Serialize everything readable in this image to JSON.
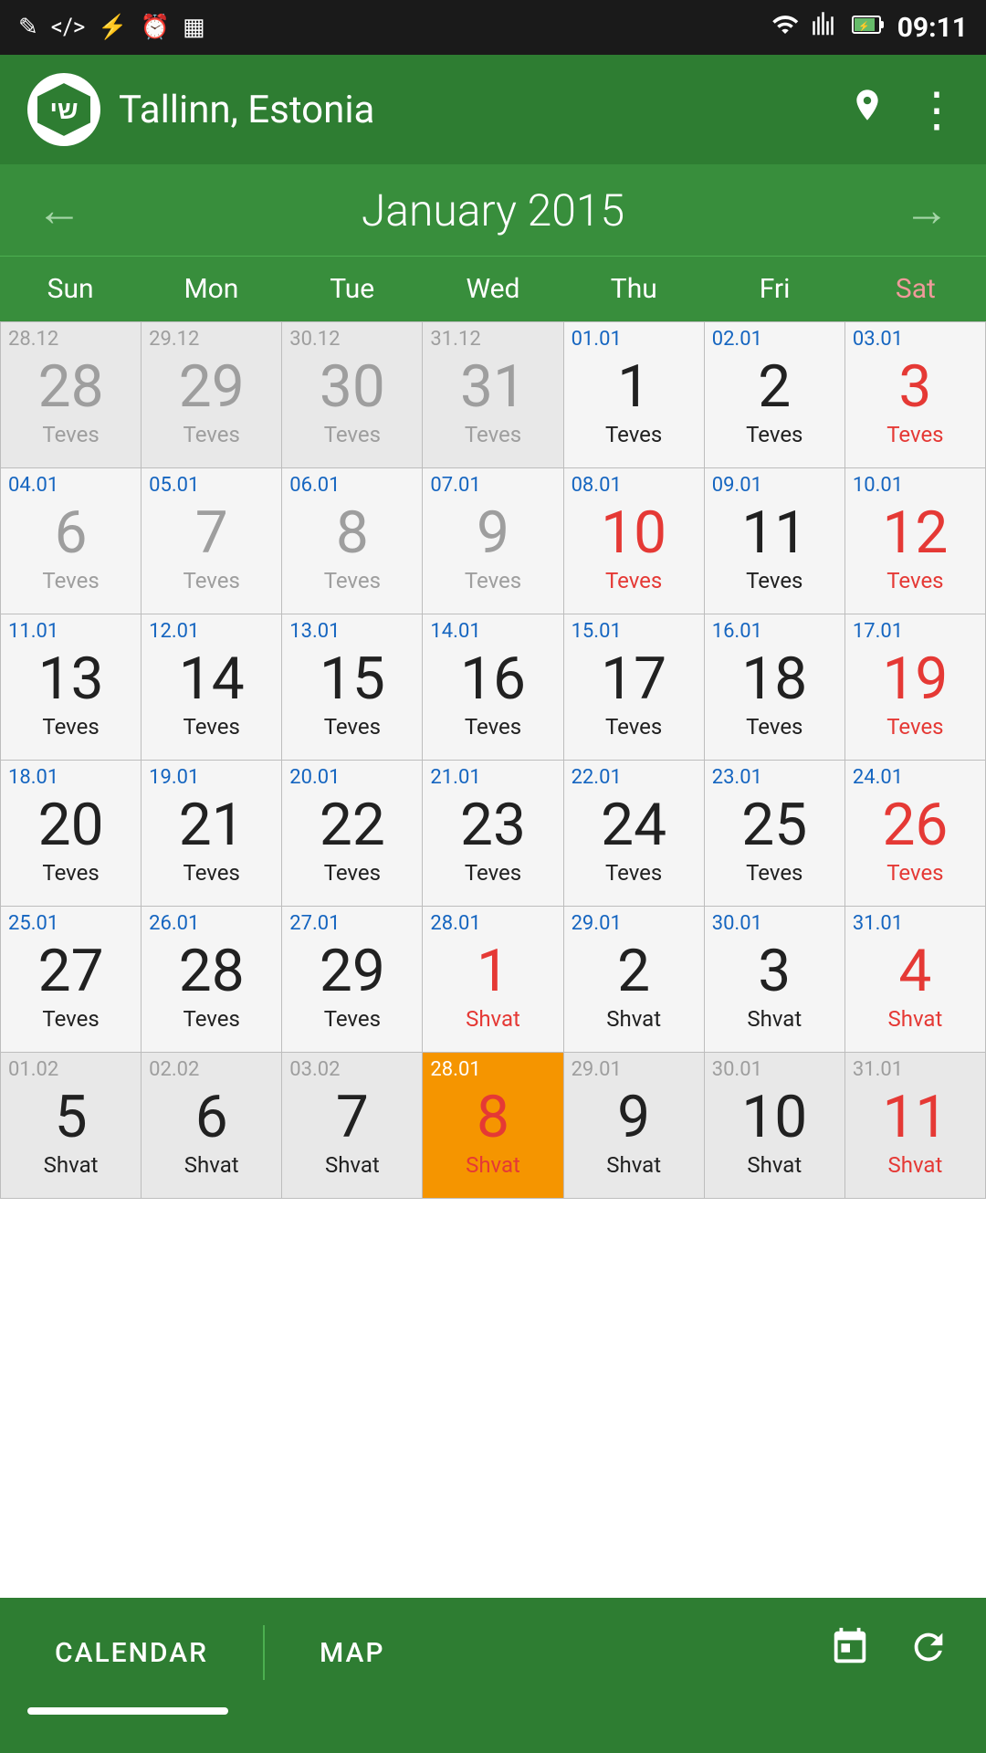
{
  "status": {
    "time": "09:11",
    "icons_left": [
      "✎",
      "<>",
      "⚡",
      "⏰",
      "▦"
    ],
    "wifi": "wifi",
    "signal": "signal",
    "battery": "battery"
  },
  "header": {
    "logo_text": "שי",
    "city": "Tallinn, Estonia",
    "location_icon": "📍",
    "menu_icon": "⋮"
  },
  "calendar": {
    "month_year": "January 2015",
    "prev_arrow": "←",
    "next_arrow": "→",
    "day_headers": [
      "Sun",
      "Mon",
      "Tue",
      "Wed",
      "Thu",
      "Fri",
      "Sat"
    ],
    "rows": [
      [
        {
          "small_date": "28.12",
          "day": "28",
          "hebrew": "Teves",
          "day_style": "gray",
          "heb_style": "gray",
          "small_style": "blue",
          "is_other": true
        },
        {
          "small_date": "29.12",
          "day": "29",
          "hebrew": "Teves",
          "day_style": "gray",
          "heb_style": "gray",
          "small_style": "blue",
          "is_other": true
        },
        {
          "small_date": "30.12",
          "day": "30",
          "hebrew": "Teves",
          "day_style": "gray",
          "heb_style": "gray",
          "small_style": "blue",
          "is_other": true
        },
        {
          "small_date": "31.12",
          "day": "31",
          "hebrew": "Teves",
          "day_style": "gray",
          "heb_style": "gray",
          "small_style": "blue",
          "is_other": true
        },
        {
          "small_date": "01.01",
          "day": "1",
          "hebrew": "Teves",
          "day_style": "black",
          "heb_style": "black",
          "small_style": "blue",
          "is_other": false
        },
        {
          "small_date": "02.01",
          "day": "2",
          "hebrew": "Teves",
          "day_style": "black",
          "heb_style": "black",
          "small_style": "blue",
          "is_other": false
        },
        {
          "small_date": "03.01",
          "day": "3",
          "hebrew": "Teves",
          "day_style": "red",
          "heb_style": "red",
          "small_style": "blue",
          "is_other": false
        }
      ],
      [
        {
          "small_date": "04.01",
          "day": "6",
          "hebrew": "Teves",
          "day_style": "gray",
          "heb_style": "gray",
          "small_style": "blue",
          "is_other": false
        },
        {
          "small_date": "05.01",
          "day": "7",
          "hebrew": "Teves",
          "day_style": "gray",
          "heb_style": "gray",
          "small_style": "blue",
          "is_other": false
        },
        {
          "small_date": "06.01",
          "day": "8",
          "hebrew": "Teves",
          "day_style": "gray",
          "heb_style": "gray",
          "small_style": "blue",
          "is_other": false
        },
        {
          "small_date": "07.01",
          "day": "9",
          "hebrew": "Teves",
          "day_style": "gray",
          "heb_style": "gray",
          "small_style": "blue",
          "is_other": false
        },
        {
          "small_date": "08.01",
          "day": "10",
          "hebrew": "Teves",
          "day_style": "red",
          "heb_style": "red",
          "small_style": "blue",
          "is_other": false
        },
        {
          "small_date": "09.01",
          "day": "11",
          "hebrew": "Teves",
          "day_style": "black",
          "heb_style": "black",
          "small_style": "blue",
          "is_other": false
        },
        {
          "small_date": "10.01",
          "day": "12",
          "hebrew": "Teves",
          "day_style": "red",
          "heb_style": "red",
          "small_style": "blue",
          "is_other": false
        }
      ],
      [
        {
          "small_date": "11.01",
          "day": "13",
          "hebrew": "Teves",
          "day_style": "black",
          "heb_style": "black",
          "small_style": "blue",
          "is_other": false
        },
        {
          "small_date": "12.01",
          "day": "14",
          "hebrew": "Teves",
          "day_style": "black",
          "heb_style": "black",
          "small_style": "blue",
          "is_other": false
        },
        {
          "small_date": "13.01",
          "day": "15",
          "hebrew": "Teves",
          "day_style": "black",
          "heb_style": "black",
          "small_style": "blue",
          "is_other": false
        },
        {
          "small_date": "14.01",
          "day": "16",
          "hebrew": "Teves",
          "day_style": "black",
          "heb_style": "black",
          "small_style": "blue",
          "is_other": false
        },
        {
          "small_date": "15.01",
          "day": "17",
          "hebrew": "Teves",
          "day_style": "black",
          "heb_style": "black",
          "small_style": "blue",
          "is_other": false
        },
        {
          "small_date": "16.01",
          "day": "18",
          "hebrew": "Teves",
          "day_style": "black",
          "heb_style": "black",
          "small_style": "blue",
          "is_other": false
        },
        {
          "small_date": "17.01",
          "day": "19",
          "hebrew": "Teves",
          "day_style": "red",
          "heb_style": "red",
          "small_style": "blue",
          "is_other": false
        }
      ],
      [
        {
          "small_date": "18.01",
          "day": "20",
          "hebrew": "Teves",
          "day_style": "black",
          "heb_style": "black",
          "small_style": "blue",
          "is_other": false
        },
        {
          "small_date": "19.01",
          "day": "21",
          "hebrew": "Teves",
          "day_style": "black",
          "heb_style": "black",
          "small_style": "blue",
          "is_other": false
        },
        {
          "small_date": "20.01",
          "day": "22",
          "hebrew": "Teves",
          "day_style": "black",
          "heb_style": "black",
          "small_style": "blue",
          "is_other": false
        },
        {
          "small_date": "21.01",
          "day": "23",
          "hebrew": "Teves",
          "day_style": "black",
          "heb_style": "black",
          "small_style": "blue",
          "is_other": false
        },
        {
          "small_date": "22.01",
          "day": "24",
          "hebrew": "Teves",
          "day_style": "black",
          "heb_style": "black",
          "small_style": "blue",
          "is_other": false
        },
        {
          "small_date": "23.01",
          "day": "25",
          "hebrew": "Teves",
          "day_style": "black",
          "heb_style": "black",
          "small_style": "blue",
          "is_other": false
        },
        {
          "small_date": "24.01",
          "day": "26",
          "hebrew": "Teves",
          "day_style": "red",
          "heb_style": "red",
          "small_style": "blue",
          "is_other": false
        }
      ],
      [
        {
          "small_date": "25.01",
          "day": "27",
          "hebrew": "Teves",
          "day_style": "black",
          "heb_style": "black",
          "small_style": "blue",
          "is_other": false
        },
        {
          "small_date": "26.01",
          "day": "28",
          "hebrew": "Teves",
          "day_style": "black",
          "heb_style": "black",
          "small_style": "blue",
          "is_other": false
        },
        {
          "small_date": "27.01",
          "day": "29",
          "hebrew": "Teves",
          "day_style": "black",
          "heb_style": "black",
          "small_style": "blue",
          "is_other": false
        },
        {
          "small_date": "28.01",
          "day": "1",
          "hebrew": "Shvat",
          "day_style": "red",
          "heb_style": "red",
          "small_style": "blue",
          "is_other": false
        },
        {
          "small_date": "29.01",
          "day": "2",
          "hebrew": "Shvat",
          "day_style": "black",
          "heb_style": "black",
          "small_style": "blue",
          "is_other": false
        },
        {
          "small_date": "30.01",
          "day": "3",
          "hebrew": "Shvat",
          "day_style": "black",
          "heb_style": "black",
          "small_style": "blue",
          "is_other": false
        },
        {
          "small_date": "31.01",
          "day": "4",
          "hebrew": "Shvat",
          "day_style": "red",
          "heb_style": "red",
          "small_style": "blue",
          "is_other": false
        }
      ],
      [
        {
          "small_date": "01.02",
          "day": "5",
          "hebrew": "Shvat",
          "day_style": "black",
          "heb_style": "black",
          "small_style": "blue",
          "is_other": true
        },
        {
          "small_date": "02.02",
          "day": "6",
          "hebrew": "Shvat",
          "day_style": "black",
          "heb_style": "black",
          "small_style": "blue",
          "is_other": true
        },
        {
          "small_date": "03.02",
          "day": "7",
          "hebrew": "Shvat",
          "day_style": "black",
          "heb_style": "black",
          "small_style": "blue",
          "is_other": true
        },
        {
          "small_date": "28.01",
          "day": "8",
          "hebrew": "Shvat",
          "day_style": "red",
          "heb_style": "red",
          "small_style": "orange",
          "is_today": true
        },
        {
          "small_date": "29.01",
          "day": "9",
          "hebrew": "Shvat",
          "day_style": "black",
          "heb_style": "black",
          "small_style": "blue",
          "is_other": true
        },
        {
          "small_date": "30.01",
          "day": "10",
          "hebrew": "Shvat",
          "day_style": "black",
          "heb_style": "black",
          "small_style": "blue",
          "is_other": true
        },
        {
          "small_date": "31.01",
          "day": "11",
          "hebrew": "Shvat",
          "day_style": "red",
          "heb_style": "red",
          "small_style": "blue",
          "is_other": true
        }
      ]
    ]
  },
  "bottom": {
    "calendar_tab": "CALENDAR",
    "map_tab": "MAP",
    "calendar_icon": "🗓",
    "refresh_icon": "↻"
  },
  "colors": {
    "green_dark": "#2e7d32",
    "green_medium": "#388e3c",
    "today_bg": "#f59500"
  }
}
